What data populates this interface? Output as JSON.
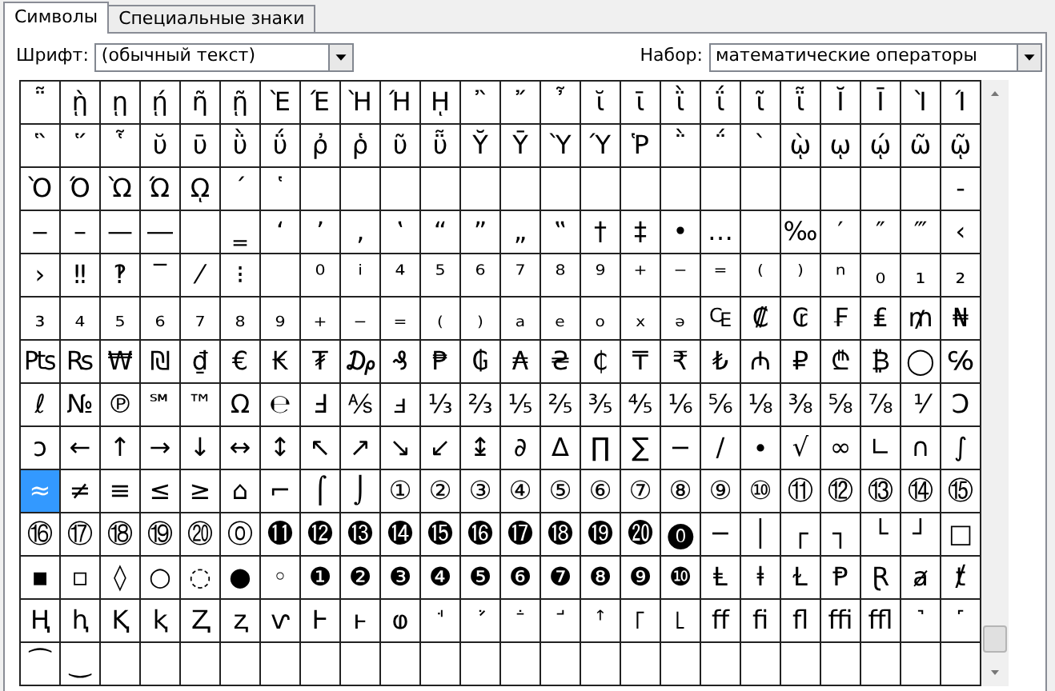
{
  "tabs": [
    {
      "label": "Символы",
      "selected": true
    },
    {
      "label": "Специальные знаки",
      "selected": false
    }
  ],
  "font_field": {
    "label": "Шрифт:",
    "value": "(обычный текст)"
  },
  "subset_field": {
    "label": "Набор:",
    "value": "математические операторы"
  },
  "grid": {
    "rows": [
      {
        "cells": [
          {
            "symbol": "῁",
            "selected": false
          },
          {
            "symbol": "ῂ",
            "selected": false
          },
          {
            "symbol": "ῃ",
            "selected": false
          },
          {
            "symbol": "ῄ",
            "selected": false
          },
          {
            "symbol": "ῆ",
            "selected": false
          },
          {
            "symbol": "ῇ",
            "selected": false
          },
          {
            "symbol": "Ὲ",
            "selected": false
          },
          {
            "symbol": "Έ",
            "selected": false
          },
          {
            "symbol": "Ὴ",
            "selected": false
          },
          {
            "symbol": "Ή",
            "selected": false
          },
          {
            "symbol": "ῌ",
            "selected": false
          },
          {
            "symbol": "῍",
            "selected": false
          },
          {
            "symbol": "῎",
            "selected": false
          },
          {
            "symbol": "῏",
            "selected": false
          },
          {
            "symbol": "ῐ",
            "selected": false
          },
          {
            "symbol": "ῑ",
            "selected": false
          },
          {
            "symbol": "ῒ",
            "selected": false
          },
          {
            "symbol": "ΐ",
            "selected": false
          },
          {
            "symbol": "ῖ",
            "selected": false
          },
          {
            "symbol": "ῗ",
            "selected": false
          },
          {
            "symbol": "Ῐ",
            "selected": false
          },
          {
            "symbol": "Ῑ",
            "selected": false
          },
          {
            "symbol": "Ὶ",
            "selected": false
          },
          {
            "symbol": "Ί",
            "selected": false
          }
        ]
      },
      {
        "cells": [
          {
            "symbol": "῝",
            "selected": false
          },
          {
            "symbol": "῞",
            "selected": false
          },
          {
            "symbol": "῟",
            "selected": false
          },
          {
            "symbol": "ῠ",
            "selected": false
          },
          {
            "symbol": "ῡ",
            "selected": false
          },
          {
            "symbol": "ῢ",
            "selected": false
          },
          {
            "symbol": "ΰ",
            "selected": false
          },
          {
            "symbol": "ῤ",
            "selected": false
          },
          {
            "symbol": "ῥ",
            "selected": false
          },
          {
            "symbol": "ῦ",
            "selected": false
          },
          {
            "symbol": "ῧ",
            "selected": false
          },
          {
            "symbol": "Ῠ",
            "selected": false
          },
          {
            "symbol": "Ῡ",
            "selected": false
          },
          {
            "symbol": "Ὺ",
            "selected": false
          },
          {
            "symbol": "Ύ",
            "selected": false
          },
          {
            "symbol": "Ῥ",
            "selected": false
          },
          {
            "symbol": "῭",
            "selected": false
          },
          {
            "symbol": "΅",
            "selected": false
          },
          {
            "symbol": "`",
            "selected": false
          },
          {
            "symbol": "ῲ",
            "selected": false
          },
          {
            "symbol": "ῳ",
            "selected": false
          },
          {
            "symbol": "ῴ",
            "selected": false
          },
          {
            "symbol": "ῶ",
            "selected": false
          },
          {
            "symbol": "ῷ",
            "selected": false
          }
        ]
      },
      {
        "cells": [
          {
            "symbol": "Ὸ",
            "selected": false
          },
          {
            "symbol": "Ό",
            "selected": false
          },
          {
            "symbol": "Ὼ",
            "selected": false
          },
          {
            "symbol": "Ώ",
            "selected": false
          },
          {
            "symbol": "ῼ",
            "selected": false
          },
          {
            "symbol": "´",
            "selected": false
          },
          {
            "symbol": "῾",
            "selected": false
          },
          {
            "selected": false
          },
          {
            "selected": false
          },
          {
            "selected": false
          },
          {
            "selected": false
          },
          {
            "selected": false
          },
          {
            "selected": false
          },
          {
            "selected": false
          },
          {
            "selected": false
          },
          {
            "selected": false
          },
          {
            "selected": false
          },
          {
            "selected": false
          },
          {
            "selected": false
          },
          {
            "selected": false
          },
          {
            "selected": false
          },
          {
            "selected": false
          },
          {
            "selected": false
          },
          {
            "symbol": "‐",
            "selected": false
          }
        ]
      },
      {
        "cells": [
          {
            "symbol": "‒",
            "selected": false
          },
          {
            "symbol": "–",
            "selected": false
          },
          {
            "symbol": "—",
            "selected": false
          },
          {
            "symbol": "―",
            "selected": false
          },
          {
            "selected": false
          },
          {
            "symbol": "‗",
            "selected": false
          },
          {
            "symbol": "‘",
            "selected": false
          },
          {
            "symbol": "’",
            "selected": false
          },
          {
            "symbol": "‚",
            "selected": false
          },
          {
            "symbol": "‛",
            "selected": false
          },
          {
            "symbol": "“",
            "selected": false
          },
          {
            "symbol": "”",
            "selected": false
          },
          {
            "symbol": "„",
            "selected": false
          },
          {
            "symbol": "‟",
            "selected": false
          },
          {
            "symbol": "†",
            "selected": false
          },
          {
            "symbol": "‡",
            "selected": false
          },
          {
            "symbol": "•",
            "selected": false
          },
          {
            "symbol": "…",
            "selected": false
          },
          {
            "selected": false
          },
          {
            "symbol": "‰",
            "selected": false
          },
          {
            "symbol": "′",
            "selected": false
          },
          {
            "symbol": "″",
            "selected": false
          },
          {
            "symbol": "‴",
            "selected": false
          },
          {
            "symbol": "‹",
            "selected": false
          }
        ]
      },
      {
        "cells": [
          {
            "symbol": "›",
            "selected": false
          },
          {
            "symbol": "‼",
            "selected": false
          },
          {
            "symbol": "‽",
            "selected": false
          },
          {
            "symbol": "‾",
            "selected": false
          },
          {
            "symbol": "⁄",
            "selected": false
          },
          {
            "symbol": "⁝",
            "selected": false
          },
          {
            "selected": false
          },
          {
            "symbol": "⁰",
            "selected": false
          },
          {
            "symbol": "ⁱ",
            "selected": false
          },
          {
            "symbol": "⁴",
            "selected": false
          },
          {
            "symbol": "⁵",
            "selected": false
          },
          {
            "symbol": "⁶",
            "selected": false
          },
          {
            "symbol": "⁷",
            "selected": false
          },
          {
            "symbol": "⁸",
            "selected": false
          },
          {
            "symbol": "⁹",
            "selected": false
          },
          {
            "symbol": "⁺",
            "selected": false
          },
          {
            "symbol": "⁻",
            "selected": false
          },
          {
            "symbol": "⁼",
            "selected": false
          },
          {
            "symbol": "⁽",
            "selected": false
          },
          {
            "symbol": "⁾",
            "selected": false
          },
          {
            "symbol": "ⁿ",
            "selected": false
          },
          {
            "symbol": "₀",
            "selected": false
          },
          {
            "symbol": "₁",
            "selected": false
          },
          {
            "symbol": "₂",
            "selected": false
          }
        ]
      },
      {
        "cells": [
          {
            "symbol": "₃",
            "selected": false
          },
          {
            "symbol": "₄",
            "selected": false
          },
          {
            "symbol": "₅",
            "selected": false
          },
          {
            "symbol": "₆",
            "selected": false
          },
          {
            "symbol": "₇",
            "selected": false
          },
          {
            "symbol": "₈",
            "selected": false
          },
          {
            "symbol": "₉",
            "selected": false
          },
          {
            "symbol": "₊",
            "selected": false
          },
          {
            "symbol": "₋",
            "selected": false
          },
          {
            "symbol": "₌",
            "selected": false
          },
          {
            "symbol": "₍",
            "selected": false
          },
          {
            "symbol": "₎",
            "selected": false
          },
          {
            "symbol": "ₐ",
            "selected": false
          },
          {
            "symbol": "ₑ",
            "selected": false
          },
          {
            "symbol": "ₒ",
            "selected": false
          },
          {
            "symbol": "ₓ",
            "selected": false
          },
          {
            "symbol": "ₔ",
            "selected": false
          },
          {
            "symbol": "₠",
            "selected": false
          },
          {
            "symbol": "₡",
            "selected": false
          },
          {
            "symbol": "₢",
            "selected": false
          },
          {
            "symbol": "₣",
            "selected": false
          },
          {
            "symbol": "₤",
            "selected": false
          },
          {
            "symbol": "₥",
            "selected": false
          },
          {
            "symbol": "₦",
            "selected": false
          }
        ]
      },
      {
        "cells": [
          {
            "symbol": "₧",
            "selected": false
          },
          {
            "symbol": "₨",
            "selected": false
          },
          {
            "symbol": "₩",
            "selected": false
          },
          {
            "symbol": "₪",
            "selected": false
          },
          {
            "symbol": "₫",
            "selected": false
          },
          {
            "symbol": "€",
            "selected": false
          },
          {
            "symbol": "₭",
            "selected": false
          },
          {
            "symbol": "₮",
            "selected": false
          },
          {
            "symbol": "₯",
            "selected": false
          },
          {
            "symbol": "₰",
            "selected": false
          },
          {
            "symbol": "₱",
            "selected": false
          },
          {
            "symbol": "₲",
            "selected": false
          },
          {
            "symbol": "₳",
            "selected": false
          },
          {
            "symbol": "₴",
            "selected": false
          },
          {
            "symbol": "₵",
            "selected": false
          },
          {
            "symbol": "₸",
            "selected": false
          },
          {
            "symbol": "₹",
            "selected": false
          },
          {
            "symbol": "₺",
            "selected": false
          },
          {
            "symbol": "₼",
            "selected": false
          },
          {
            "symbol": "₽",
            "selected": false
          },
          {
            "symbol": "₾",
            "selected": false
          },
          {
            "symbol": "₿",
            "selected": false
          },
          {
            "symbol": "◯",
            "selected": false
          },
          {
            "symbol": "℅",
            "selected": false
          }
        ]
      },
      {
        "cells": [
          {
            "symbol": "ℓ",
            "selected": false
          },
          {
            "symbol": "№",
            "selected": false
          },
          {
            "symbol": "℗",
            "selected": false
          },
          {
            "symbol": "℠",
            "selected": false
          },
          {
            "symbol": "™",
            "selected": false
          },
          {
            "symbol": "Ω",
            "selected": false
          },
          {
            "symbol": "℮",
            "selected": false
          },
          {
            "symbol": "Ⅎ",
            "selected": false
          },
          {
            "symbol": "⅍",
            "selected": false
          },
          {
            "symbol": "ⅎ",
            "selected": false
          },
          {
            "symbol": "⅓",
            "selected": false
          },
          {
            "symbol": "⅔",
            "selected": false
          },
          {
            "symbol": "⅕",
            "selected": false
          },
          {
            "symbol": "⅖",
            "selected": false
          },
          {
            "symbol": "⅗",
            "selected": false
          },
          {
            "symbol": "⅘",
            "selected": false
          },
          {
            "symbol": "⅙",
            "selected": false
          },
          {
            "symbol": "⅚",
            "selected": false
          },
          {
            "symbol": "⅛",
            "selected": false
          },
          {
            "symbol": "⅜",
            "selected": false
          },
          {
            "symbol": "⅝",
            "selected": false
          },
          {
            "symbol": "⅞",
            "selected": false
          },
          {
            "symbol": "⅟",
            "selected": false
          },
          {
            "symbol": "Ↄ",
            "selected": false
          }
        ]
      },
      {
        "cells": [
          {
            "symbol": "ↄ",
            "selected": false
          },
          {
            "symbol": "←",
            "selected": false
          },
          {
            "symbol": "↑",
            "selected": false
          },
          {
            "symbol": "→",
            "selected": false
          },
          {
            "symbol": "↓",
            "selected": false
          },
          {
            "symbol": "↔",
            "selected": false
          },
          {
            "symbol": "↕",
            "selected": false
          },
          {
            "symbol": "↖",
            "selected": false
          },
          {
            "symbol": "↗",
            "selected": false
          },
          {
            "symbol": "↘",
            "selected": false
          },
          {
            "symbol": "↙",
            "selected": false
          },
          {
            "symbol": "↨",
            "selected": false
          },
          {
            "symbol": "∂",
            "selected": false
          },
          {
            "symbol": "∆",
            "selected": false
          },
          {
            "symbol": "∏",
            "selected": false
          },
          {
            "symbol": "∑",
            "selected": false
          },
          {
            "symbol": "−",
            "selected": false
          },
          {
            "symbol": "∕",
            "selected": false
          },
          {
            "symbol": "∙",
            "selected": false
          },
          {
            "symbol": "√",
            "selected": false
          },
          {
            "symbol": "∞",
            "selected": false
          },
          {
            "symbol": "∟",
            "selected": false
          },
          {
            "symbol": "∩",
            "selected": false
          },
          {
            "symbol": "∫",
            "selected": false
          }
        ]
      },
      {
        "cells": [
          {
            "symbol": "≈",
            "selected": true
          },
          {
            "symbol": "≠",
            "selected": false
          },
          {
            "symbol": "≡",
            "selected": false
          },
          {
            "symbol": "≤",
            "selected": false
          },
          {
            "symbol": "≥",
            "selected": false
          },
          {
            "symbol": "⌂",
            "selected": false
          },
          {
            "symbol": "⌐",
            "selected": false
          },
          {
            "symbol": "⌠",
            "selected": false
          },
          {
            "symbol": "⌡",
            "selected": false
          },
          {
            "symbol": "①",
            "selected": false
          },
          {
            "symbol": "②",
            "selected": false
          },
          {
            "symbol": "③",
            "selected": false
          },
          {
            "symbol": "④",
            "selected": false
          },
          {
            "symbol": "⑤",
            "selected": false
          },
          {
            "symbol": "⑥",
            "selected": false
          },
          {
            "symbol": "⑦",
            "selected": false
          },
          {
            "symbol": "⑧",
            "selected": false
          },
          {
            "symbol": "⑨",
            "selected": false
          },
          {
            "symbol": "⑩",
            "selected": false
          },
          {
            "symbol": "⑪",
            "selected": false
          },
          {
            "symbol": "⑫",
            "selected": false
          },
          {
            "symbol": "⑬",
            "selected": false
          },
          {
            "symbol": "⑭",
            "selected": false
          },
          {
            "symbol": "⑮",
            "selected": false
          }
        ]
      },
      {
        "cells": [
          {
            "symbol": "⑯",
            "selected": false
          },
          {
            "symbol": "⑰",
            "selected": false
          },
          {
            "symbol": "⑱",
            "selected": false
          },
          {
            "symbol": "⑲",
            "selected": false
          },
          {
            "symbol": "⑳",
            "selected": false
          },
          {
            "symbol": "⓪",
            "selected": false
          },
          {
            "symbol": "⓫",
            "selected": false
          },
          {
            "symbol": "⓬",
            "selected": false
          },
          {
            "symbol": "⓭",
            "selected": false
          },
          {
            "symbol": "⓮",
            "selected": false
          },
          {
            "symbol": "⓯",
            "selected": false
          },
          {
            "symbol": "⓰",
            "selected": false
          },
          {
            "symbol": "⓱",
            "selected": false
          },
          {
            "symbol": "⓲",
            "selected": false
          },
          {
            "symbol": "⓳",
            "selected": false
          },
          {
            "symbol": "⓴",
            "selected": false
          },
          {
            "symbol": "⓿",
            "selected": false
          },
          {
            "symbol": "─",
            "selected": false
          },
          {
            "symbol": "│",
            "selected": false
          },
          {
            "symbol": "┌",
            "selected": false
          },
          {
            "symbol": "┐",
            "selected": false
          },
          {
            "symbol": "└",
            "selected": false
          },
          {
            "symbol": "┘",
            "selected": false
          },
          {
            "symbol": "□",
            "selected": false
          }
        ]
      },
      {
        "cells": [
          {
            "symbol": "▪",
            "selected": false
          },
          {
            "symbol": "▫",
            "selected": false
          },
          {
            "symbol": "◊",
            "selected": false
          },
          {
            "symbol": "○",
            "selected": false
          },
          {
            "symbol": "◌",
            "selected": false
          },
          {
            "symbol": "●",
            "selected": false
          },
          {
            "symbol": "◦",
            "selected": false
          },
          {
            "symbol": "❶",
            "selected": false
          },
          {
            "symbol": "❷",
            "selected": false
          },
          {
            "symbol": "❸",
            "selected": false
          },
          {
            "symbol": "❹",
            "selected": false
          },
          {
            "symbol": "❺",
            "selected": false
          },
          {
            "symbol": "❻",
            "selected": false
          },
          {
            "symbol": "❼",
            "selected": false
          },
          {
            "symbol": "❽",
            "selected": false
          },
          {
            "symbol": "❾",
            "selected": false
          },
          {
            "symbol": "❿",
            "selected": false
          },
          {
            "symbol": "Ⱡ",
            "selected": false
          },
          {
            "symbol": "ⱡ",
            "selected": false
          },
          {
            "symbol": "Ɫ",
            "selected": false
          },
          {
            "symbol": "Ᵽ",
            "selected": false
          },
          {
            "symbol": "Ɽ",
            "selected": false
          },
          {
            "symbol": "ⱥ",
            "selected": false
          },
          {
            "symbol": "ⱦ",
            "selected": false
          }
        ]
      },
      {
        "cells": [
          {
            "symbol": "Ⱨ",
            "selected": false
          },
          {
            "symbol": "ⱨ",
            "selected": false
          },
          {
            "symbol": "Ⱪ",
            "selected": false
          },
          {
            "symbol": "ⱪ",
            "selected": false
          },
          {
            "symbol": "Ⱬ",
            "selected": false
          },
          {
            "symbol": "ⱬ",
            "selected": false
          },
          {
            "symbol": "ⱱ",
            "selected": false
          },
          {
            "symbol": "Ⱶ",
            "selected": false
          },
          {
            "symbol": "ⱶ",
            "selected": false
          },
          {
            "symbol": "ⱷ",
            "selected": false
          },
          {
            "symbol": "ꜗ",
            "selected": false
          },
          {
            "symbol": "ꜘ",
            "selected": false
          },
          {
            "symbol": "ꜙ",
            "selected": false
          },
          {
            "symbol": "ꜚ",
            "selected": false
          },
          {
            "symbol": "ꜛ",
            "selected": false
          },
          {
            "symbol": "꜒",
            "selected": false
          },
          {
            "symbol": "꜖",
            "selected": false
          },
          {
            "symbol": "ﬀ",
            "selected": false
          },
          {
            "symbol": "ﬁ",
            "selected": false
          },
          {
            "symbol": "ﬂ",
            "selected": false
          },
          {
            "symbol": "ﬃ",
            "selected": false
          },
          {
            "symbol": "ﬄ",
            "selected": false
          },
          {
            "symbol": "˺",
            "selected": false
          },
          {
            "symbol": "˹",
            "selected": false
          }
        ]
      },
      {
        "cells": [
          {
            "symbol": "⁀",
            "selected": false
          },
          {
            "symbol": "‿",
            "selected": false
          },
          {
            "selected": false
          },
          {
            "selected": false
          },
          {
            "selected": false
          },
          {
            "selected": false
          },
          {
            "selected": false
          },
          {
            "selected": false
          },
          {
            "selected": false
          },
          {
            "selected": false
          },
          {
            "selected": false
          },
          {
            "selected": false
          },
          {
            "selected": false
          },
          {
            "selected": false
          },
          {
            "selected": false
          },
          {
            "selected": false
          },
          {
            "selected": false
          },
          {
            "selected": false
          },
          {
            "selected": false
          },
          {
            "selected": false
          },
          {
            "selected": false
          },
          {
            "selected": false
          },
          {
            "selected": false
          },
          {
            "selected": false
          }
        ]
      }
    ]
  }
}
